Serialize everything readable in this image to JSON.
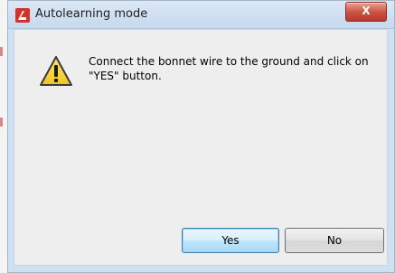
{
  "window": {
    "title": "Autolearning mode",
    "app_icon": "app-logo-icon",
    "close_label": "X"
  },
  "dialog": {
    "icon": "warning-icon",
    "message": "Connect the bonnet wire to the ground and click on \"YES\" button."
  },
  "buttons": {
    "yes_label": "Yes",
    "no_label": "No"
  },
  "colors": {
    "title_bar": "#cfe0f2",
    "client_bg": "#eeeeee",
    "close_button": "#c9503f",
    "default_button_border": "#3c7fb1",
    "warning_yellow": "#f5d327"
  }
}
